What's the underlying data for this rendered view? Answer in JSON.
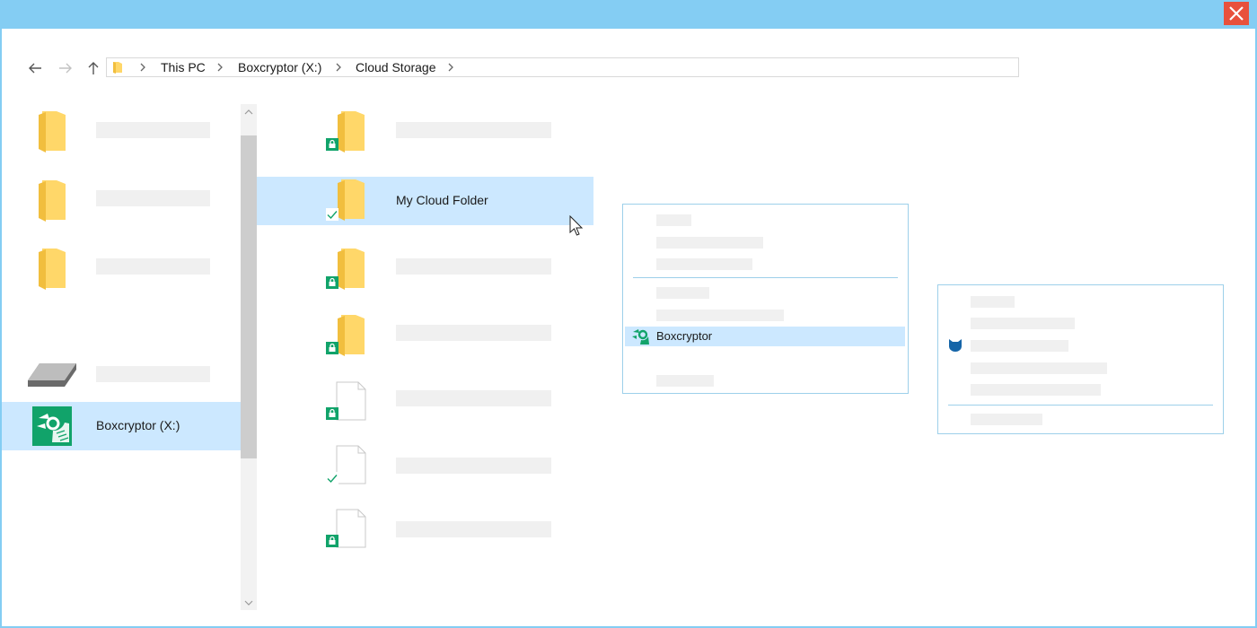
{
  "window": {
    "close_icon": "close-icon",
    "accent": "#84cdf3",
    "close_color": "#e8513c"
  },
  "nav": {
    "back_icon": "arrow-left-icon",
    "forward_icon": "arrow-right-icon",
    "up_icon": "arrow-up-icon"
  },
  "breadcrumb": [
    "This PC",
    "Boxcryptor (X:)",
    "Cloud Storage"
  ],
  "sidebar": {
    "selected_drive": "Boxcryptor (X:)",
    "selection_color": "#cce8ff"
  },
  "files": {
    "selected_folder": "My Cloud Folder",
    "status_icons": [
      "lock-badge-icon",
      "sync-check-icon"
    ],
    "lock_color": "#11a36a"
  },
  "context_menu": {
    "highlighted_item": "Boxcryptor"
  }
}
